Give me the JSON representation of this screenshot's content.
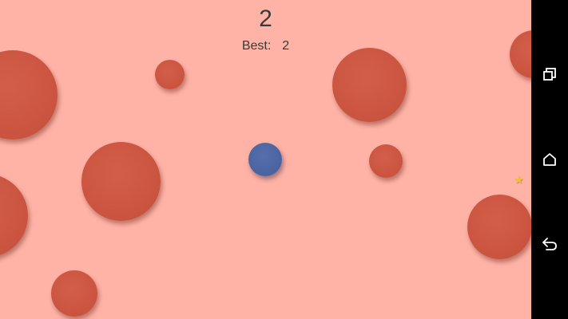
{
  "hud": {
    "score": "2",
    "best_label": "Best:",
    "best_value": "2"
  },
  "colors": {
    "background": "#ffb3a6",
    "obstacle": "#cb5540",
    "player": "#4a62a0",
    "star": "#f2c230",
    "navbar": "#000000"
  },
  "navbar": {
    "buttons": [
      "recent-apps",
      "home",
      "back"
    ]
  }
}
